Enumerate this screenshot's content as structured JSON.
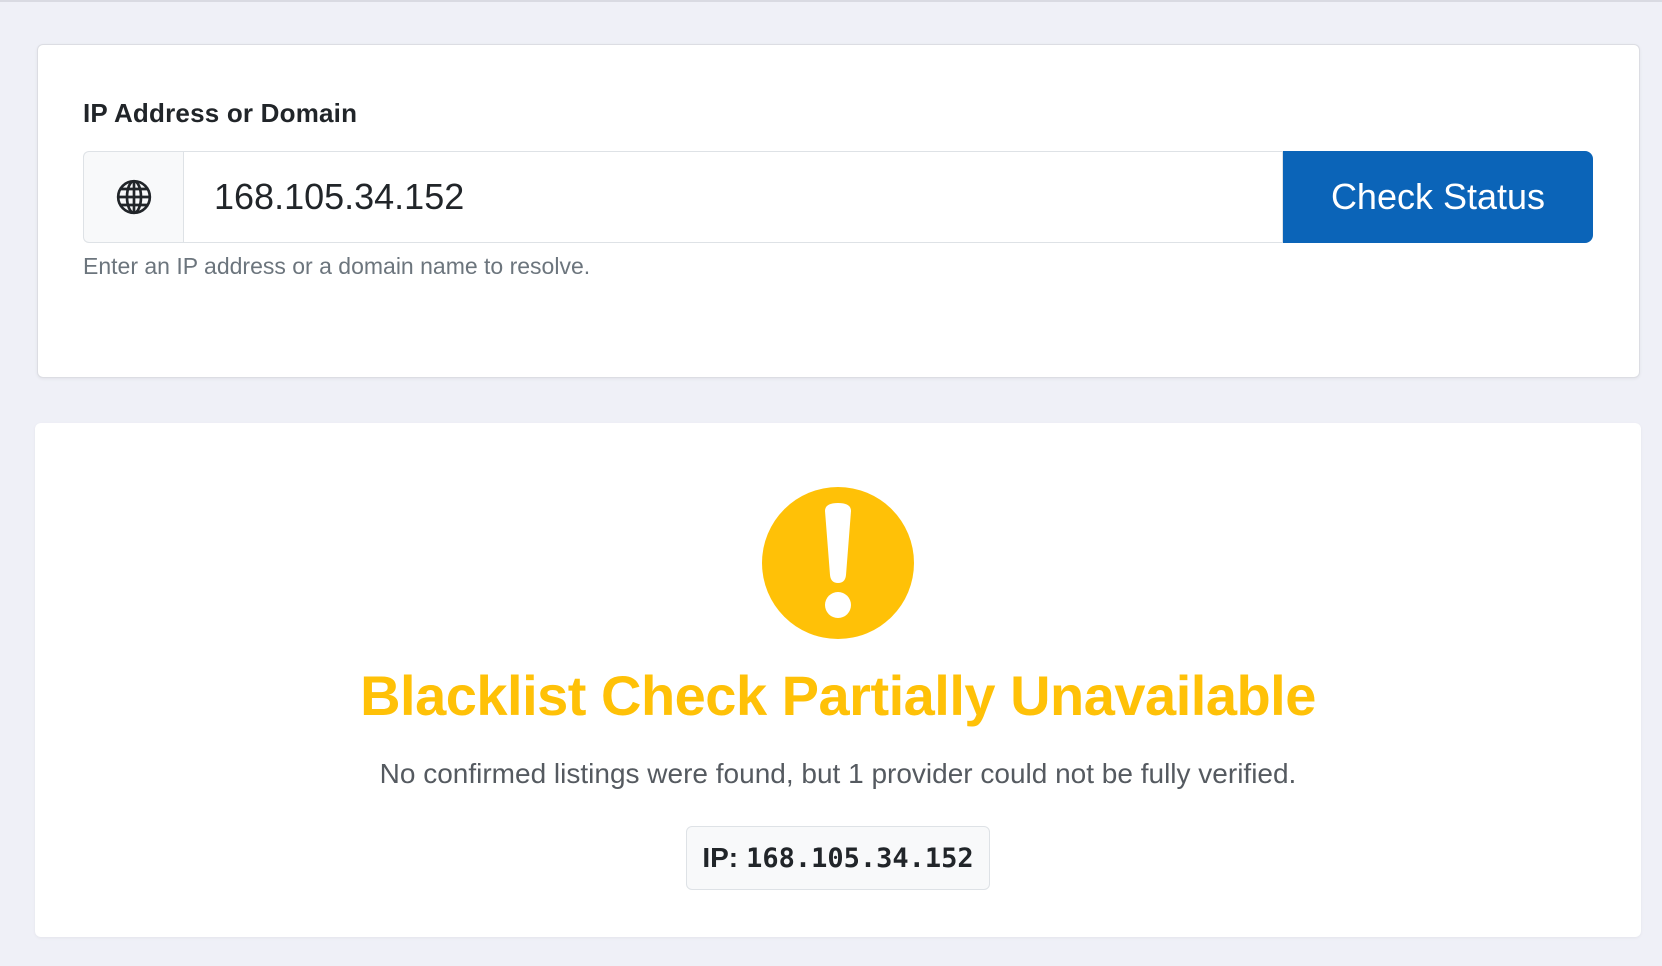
{
  "form": {
    "label": "IP Address or Domain",
    "input_value": "168.105.34.152",
    "input_prefix_icon": "globe-icon",
    "button_label": "Check Status",
    "help_text": "Enter an IP address or a domain name to resolve."
  },
  "result": {
    "status_icon": "exclamation-icon",
    "title": "Blacklist Check Partially Unavailable",
    "description": "No confirmed listings were found, but 1 provider could not be fully verified.",
    "ip_prefix": "IP:",
    "ip_value": "168.105.34.152"
  },
  "colors": {
    "page_bg": "#eff0f7",
    "primary": "#0b64b8",
    "warning": "#ffc107",
    "muted_text": "#6c757d"
  }
}
